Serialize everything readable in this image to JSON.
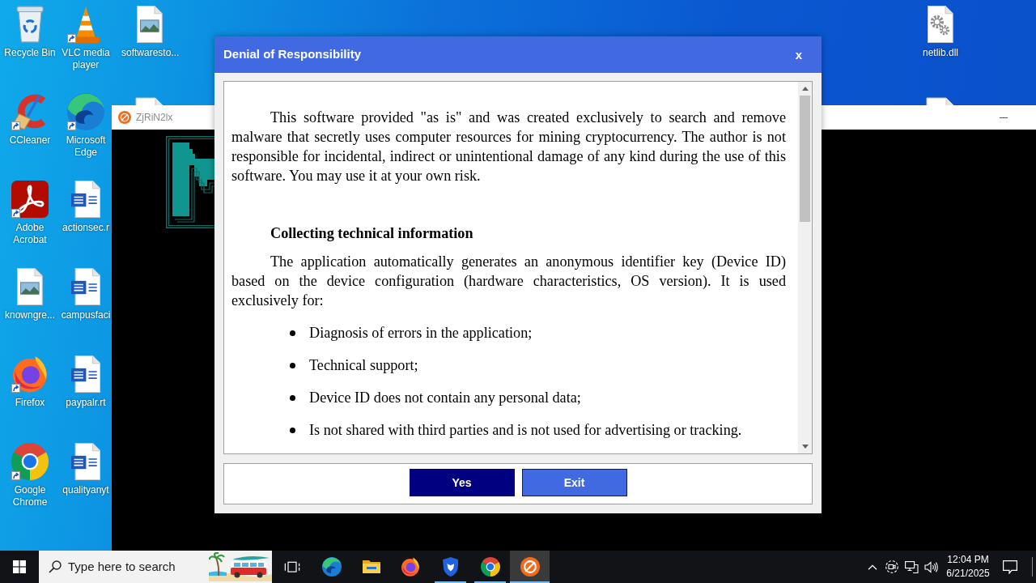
{
  "desktop": {
    "columns": [
      {
        "icons": [
          {
            "kind": "recycle-bin",
            "label": "Recycle Bin",
            "shortcut": false
          },
          {
            "kind": "cleaner",
            "label": "CCleaner",
            "shortcut": true
          },
          {
            "kind": "pdf-app",
            "label": "Adobe Acrobat",
            "shortcut": true
          },
          {
            "kind": "image-file",
            "label": "knowngre...",
            "shortcut": false
          },
          {
            "kind": "fox-browser",
            "label": "Firefox",
            "shortcut": true
          },
          {
            "kind": "round-browser",
            "label": "Google Chrome",
            "shortcut": true
          }
        ]
      },
      {
        "icons": [
          {
            "kind": "cone",
            "label": "VLC media player",
            "shortcut": true
          },
          {
            "kind": "wave-browser",
            "label": "Microsoft Edge",
            "shortcut": true
          },
          {
            "kind": "document",
            "label": "actionsec.r",
            "shortcut": false
          },
          {
            "kind": "document",
            "label": "campusfaci",
            "shortcut": false
          },
          {
            "kind": "document",
            "label": "paypalr.rt",
            "shortcut": false
          },
          {
            "kind": "document",
            "label": "qualityanyt",
            "shortcut": false
          }
        ]
      },
      {
        "icons": [
          {
            "kind": "image-file",
            "label": "softwaresto...",
            "shortcut": false
          },
          {
            "kind": "partial-file",
            "shortcut": false
          }
        ]
      }
    ],
    "right_column": {
      "icons": [
        {
          "kind": "gear-file",
          "label": "netlib.dll",
          "shortcut": false
        },
        {
          "kind": "partial-file",
          "shortcut": false
        }
      ]
    }
  },
  "background_window": {
    "title": "ZjRiN2lx"
  },
  "dialog": {
    "title": "Denial of Responsibility",
    "close": "x",
    "content": [
      {
        "kind": "paragraph",
        "text": "This software provided \"as is\" and was created exclusively to search and remove malware that secretly uses computer resources for mining cryptocurrency. The author is not responsible for incidental, indirect or unintentional damage of any kind during the use of this software. You may use it at your own risk."
      },
      {
        "kind": "heading",
        "text": "Collecting technical information"
      },
      {
        "kind": "paragraph",
        "text": "The application automatically generates an anonymous identifier key (Device ID) based on the device configuration (hardware characteristics, OS version). It is used exclusively for:"
      },
      {
        "kind": "bullet",
        "text": "Diagnosis of errors in the application;"
      },
      {
        "kind": "bullet",
        "text": "Technical support;"
      },
      {
        "kind": "bullet",
        "text": "Device ID does not contain any personal data;"
      },
      {
        "kind": "bullet",
        "text": "Is not shared with third parties and is not used for advertising or tracking."
      }
    ],
    "buttons": [
      {
        "label": "Yes",
        "kind": "primary"
      },
      {
        "label": "Exit",
        "kind": "secondary"
      }
    ]
  },
  "taskbar": {
    "search": {
      "placeholder": "Type here to search"
    },
    "items": [
      {
        "kind": "task-view",
        "running": false,
        "active": false
      },
      {
        "kind": "wave-browser",
        "running": false,
        "active": false
      },
      {
        "kind": "folder",
        "running": false,
        "active": false
      },
      {
        "kind": "fox-browser",
        "running": false,
        "active": false
      },
      {
        "kind": "shield",
        "running": true,
        "active": false
      },
      {
        "kind": "round-browser",
        "running": true,
        "active": false
      },
      {
        "kind": "app",
        "running": true,
        "active": true
      }
    ],
    "clock": {
      "time": "12:04 PM",
      "date": "6/21/2025"
    }
  }
}
